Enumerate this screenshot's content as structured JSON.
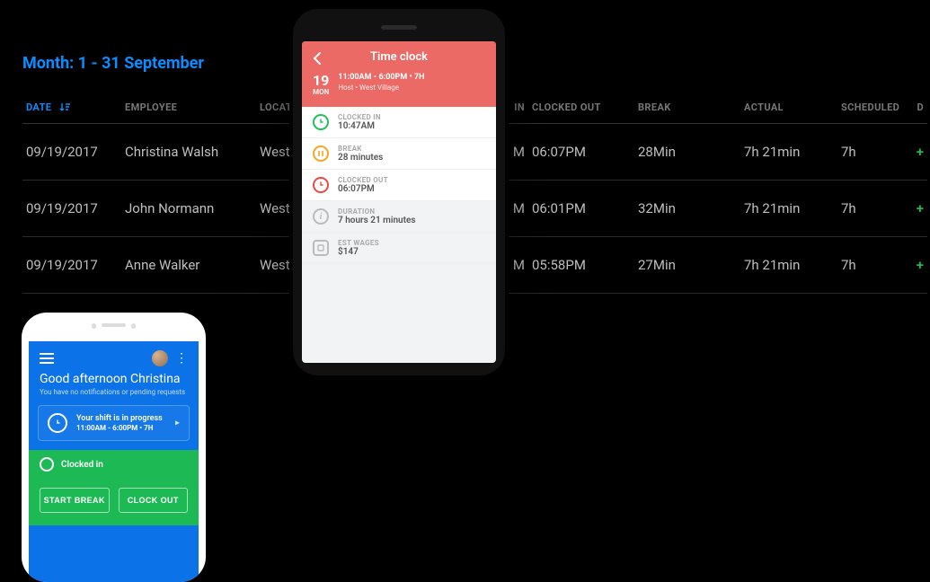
{
  "page": {
    "month_label": "Month: 1 - 31 September"
  },
  "columns": {
    "date": "DATE",
    "employee": "EMPLOYEE",
    "location_prefix": "LOCATI",
    "clocked_in_suffix": "IN",
    "clocked_out": "CLOCKED OUT",
    "break": "BREAK",
    "actual": "ACTUAL",
    "scheduled": "SCHEDULED",
    "diff_initial": "D"
  },
  "rows": [
    {
      "date": "09/19/2017",
      "employee": "Christina Walsh",
      "location": "West V",
      "in_suffix": "M",
      "out": "06:07PM",
      "break": "28Min",
      "actual": "7h 21min",
      "scheduled": "7h",
      "diff": "+"
    },
    {
      "date": "09/19/2017",
      "employee": "John Normann",
      "location": "West V",
      "in_suffix": "M",
      "out": "06:01PM",
      "break": "32Min",
      "actual": "7h 21min",
      "scheduled": "7h",
      "diff": "+"
    },
    {
      "date": "09/19/2017",
      "employee": "Anne Walker",
      "location": "West V",
      "in_suffix": "M",
      "out": "05:58PM",
      "break": "27Min",
      "actual": "7h 21min",
      "scheduled": "7h",
      "diff": "+"
    }
  ],
  "timeclock": {
    "title": "Time clock",
    "date_num": "19",
    "date_day": "MON",
    "shift_line": "11:00AM - 6:00PM • 7H",
    "loc_line": "Host • West Village",
    "items": [
      {
        "label": "CLOCKED IN",
        "value": "10:47AM",
        "icon": "green",
        "glyph": "clock",
        "muted": false
      },
      {
        "label": "BREAK",
        "value": "28 minutes",
        "icon": "orange",
        "glyph": "pause",
        "muted": false
      },
      {
        "label": "CLOCKED OUT",
        "value": "06:07PM",
        "icon": "red",
        "glyph": "clock",
        "muted": false
      },
      {
        "label": "DURATION",
        "value": "7 hours 21 minutes",
        "icon": "gray",
        "glyph": "info",
        "muted": true
      },
      {
        "label": "EST WAGES",
        "value": "$147",
        "icon": "gray",
        "glyph": "square",
        "muted": true
      }
    ]
  },
  "dashboard": {
    "greeting": "Good afternoon Christina",
    "sub": "You have no notifications or pending requests",
    "shift_title": "Your shift is in progress",
    "shift_sub": "11:00AM - 6:00PM • 7H",
    "clocked_in": "Clocked in",
    "start_break": "START BREAK",
    "clock_out": "CLOCK OUT"
  }
}
